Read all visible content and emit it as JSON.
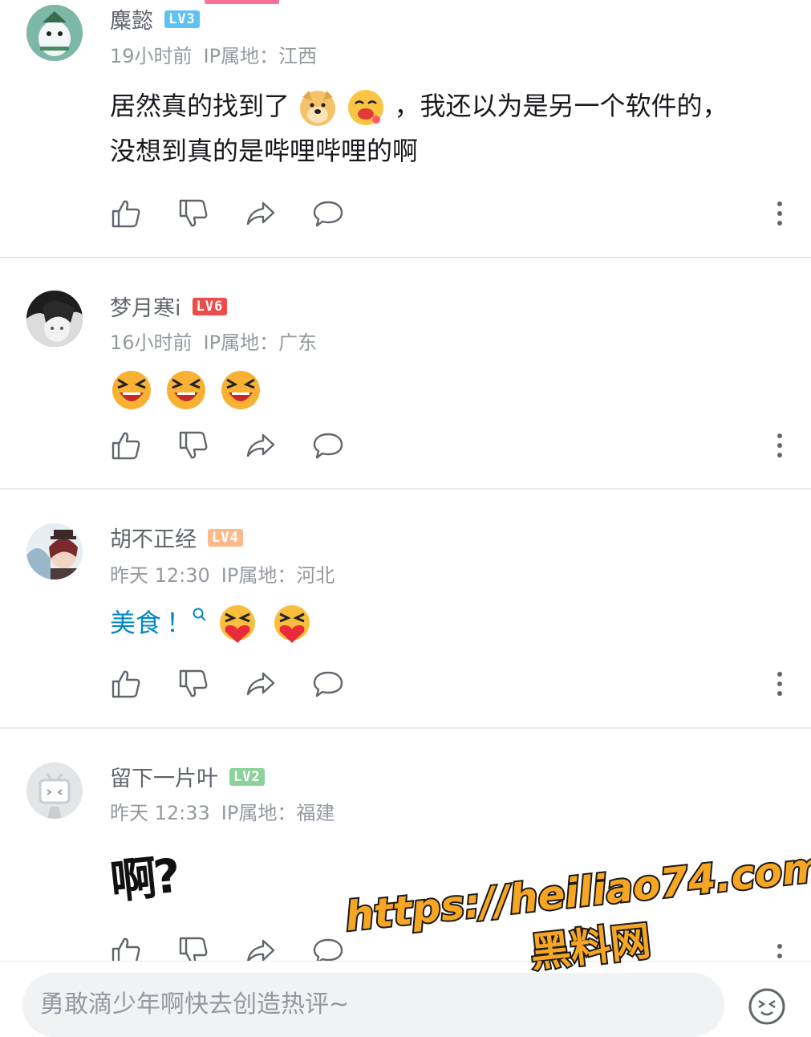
{
  "comments": [
    {
      "username": "麋懿",
      "level": "LV3",
      "level_color": "#5dc1f1",
      "time": "19小时前",
      "ip": "IP属地：江西",
      "text_1": "居然真的找到了",
      "text_2": "，我还以为是另一个软件的，",
      "text_3": "没想到真的是哔哩哔哩的啊",
      "emojis": [
        "doge-emoji",
        "drool-emoji"
      ]
    },
    {
      "username": "梦月寒i",
      "level": "LV6",
      "level_color": "#ee4b4b",
      "time": "16小时前",
      "ip": "IP属地：广东",
      "emojis": [
        "laugh-emoji",
        "laugh-emoji",
        "laugh-emoji"
      ]
    },
    {
      "username": "胡不正经",
      "level": "LV4",
      "level_color": "#feb989",
      "time": "昨天 12:30",
      "ip": "IP属地：河北",
      "text_1": "美食",
      "text_2": "！",
      "emojis": [
        "heart-hug-emoji",
        "heart-hug-emoji"
      ]
    },
    {
      "username": "留下一片叶",
      "level": "LV2",
      "level_color": "#8bd29b",
      "time": "昨天 12:33",
      "ip": "IP属地：福建",
      "sticker_text": "啊?"
    }
  ],
  "actions": [
    "like-icon",
    "dislike-icon",
    "share-icon",
    "reply-icon",
    "more-icon"
  ],
  "reply_bar": {
    "placeholder": "勇敢滴少年啊快去创造热评~"
  },
  "watermark": {
    "url": "https://heiliao74.com",
    "name": "黑料网"
  },
  "colors": {
    "keyword": "#008ac5",
    "accent": "#fb7299",
    "watermark": "#f6a623"
  }
}
